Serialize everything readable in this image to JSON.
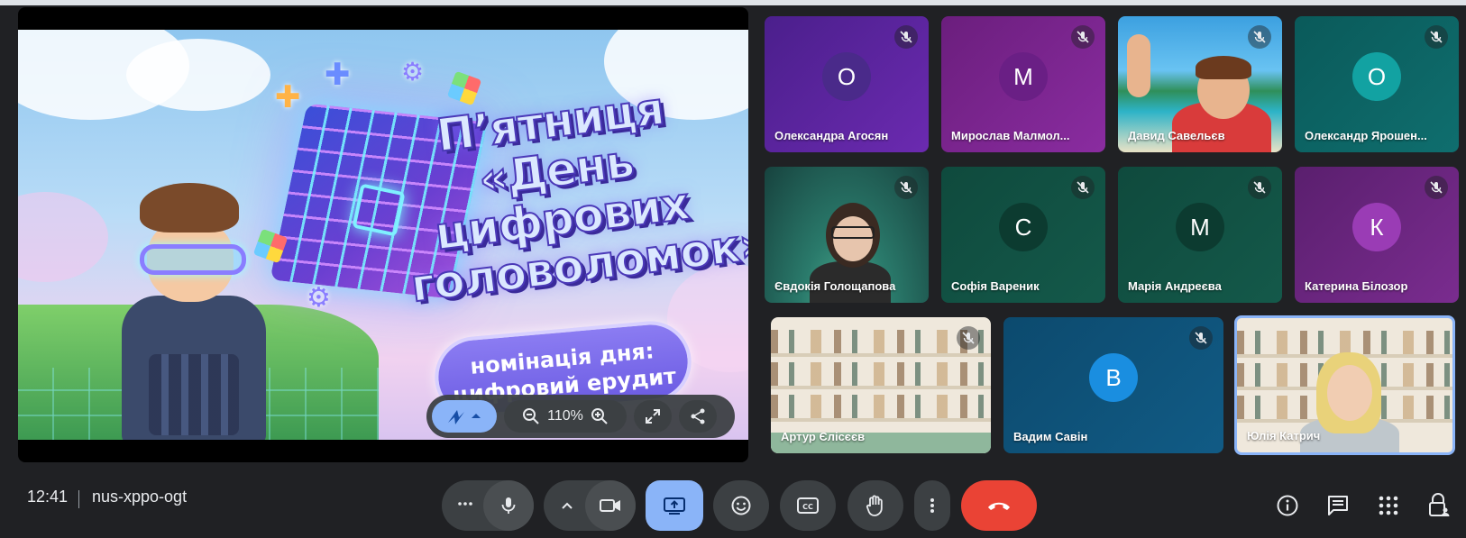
{
  "presentation": {
    "slide_title": "П’ятниця «День цифрових головоломок»",
    "slide_nomination": "номінація дня: цифровий ерудит",
    "zoom_level": "110%"
  },
  "participants": [
    {
      "name": "Олександра Агосян",
      "initial": "О",
      "muted": true
    },
    {
      "name": "Мирослав Малмол...",
      "initial": "М",
      "muted": true
    },
    {
      "name": "Давид Савельєв",
      "muted": true
    },
    {
      "name": "Олександр Ярошен...",
      "initial": "О",
      "muted": true
    },
    {
      "name": "Євдокія Голощапова",
      "muted": true
    },
    {
      "name": "Софія Вареник",
      "initial": "С",
      "muted": true
    },
    {
      "name": "Марія Андреєва",
      "initial": "М",
      "muted": true
    },
    {
      "name": "Катерина Білозор",
      "initial": "К",
      "muted": true
    },
    {
      "name": "Артур Єлісєєв",
      "muted": true
    },
    {
      "name": "Вадим Савін",
      "initial": "В",
      "muted": true
    },
    {
      "name": "Юлія Катрич",
      "muted": false
    }
  ],
  "meeting": {
    "time": "12:41",
    "code": "nus-xppo-ogt"
  },
  "colors": {
    "accent": "#8ab4f8",
    "end_call": "#ea4335",
    "background": "#202124"
  }
}
